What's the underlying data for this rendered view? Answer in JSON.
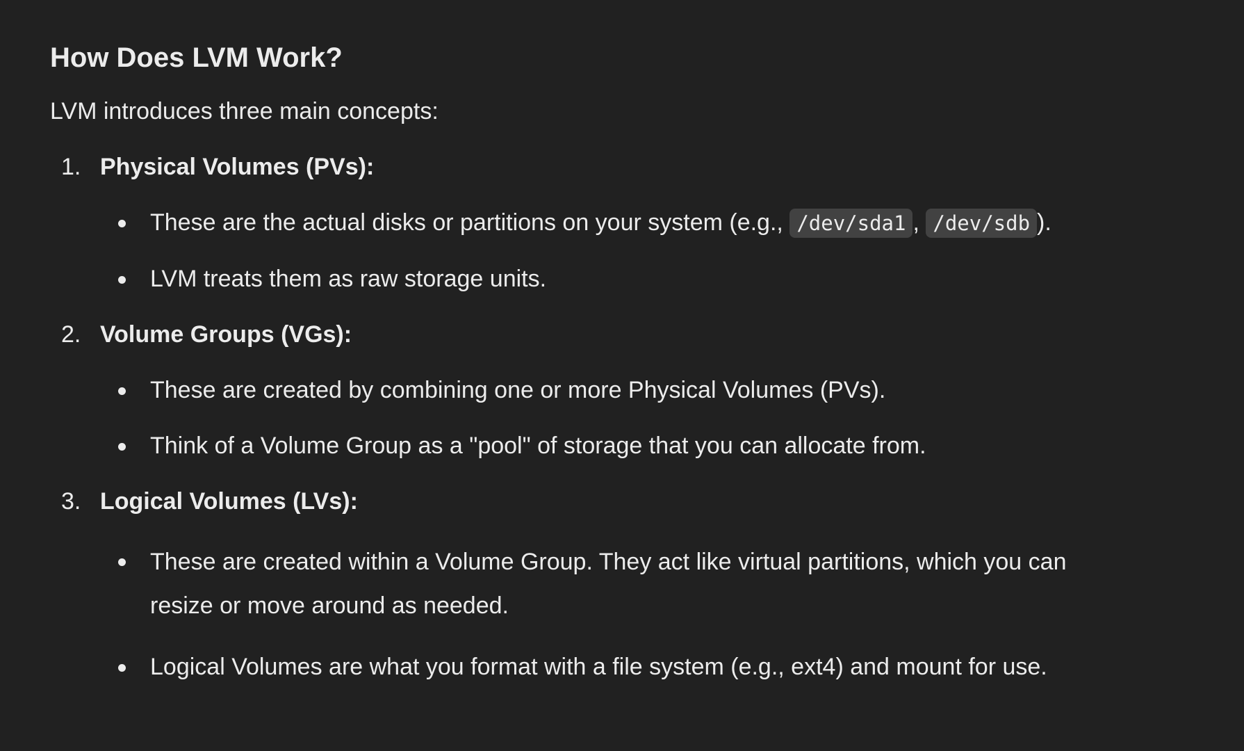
{
  "heading": "How Does LVM Work?",
  "intro": "LVM introduces three main concepts:",
  "concepts": [
    {
      "number": "1.",
      "title": "Physical Volumes (PVs):",
      "bullets": [
        {
          "before": "These are the actual disks or partitions on your system (e.g., ",
          "code1": "/dev/sda1",
          "between": ", ",
          "code2": "/dev/sdb",
          "after": ")."
        },
        {
          "text": "LVM treats them as raw storage units."
        }
      ]
    },
    {
      "number": "2.",
      "title": "Volume Groups (VGs):",
      "bullets": [
        {
          "text": "These are created by combining one or more Physical Volumes (PVs)."
        },
        {
          "text": "Think of a Volume Group as a \"pool\" of storage that you can allocate from."
        }
      ]
    },
    {
      "number": "3.",
      "title": "Logical Volumes (LVs):",
      "bullets": [
        {
          "text": "These are created within a Volume Group. They act like virtual partitions, which you can resize or move around as needed."
        },
        {
          "text": "Logical Volumes are what you format with a file system (e.g., ext4) and mount for use."
        }
      ]
    }
  ]
}
